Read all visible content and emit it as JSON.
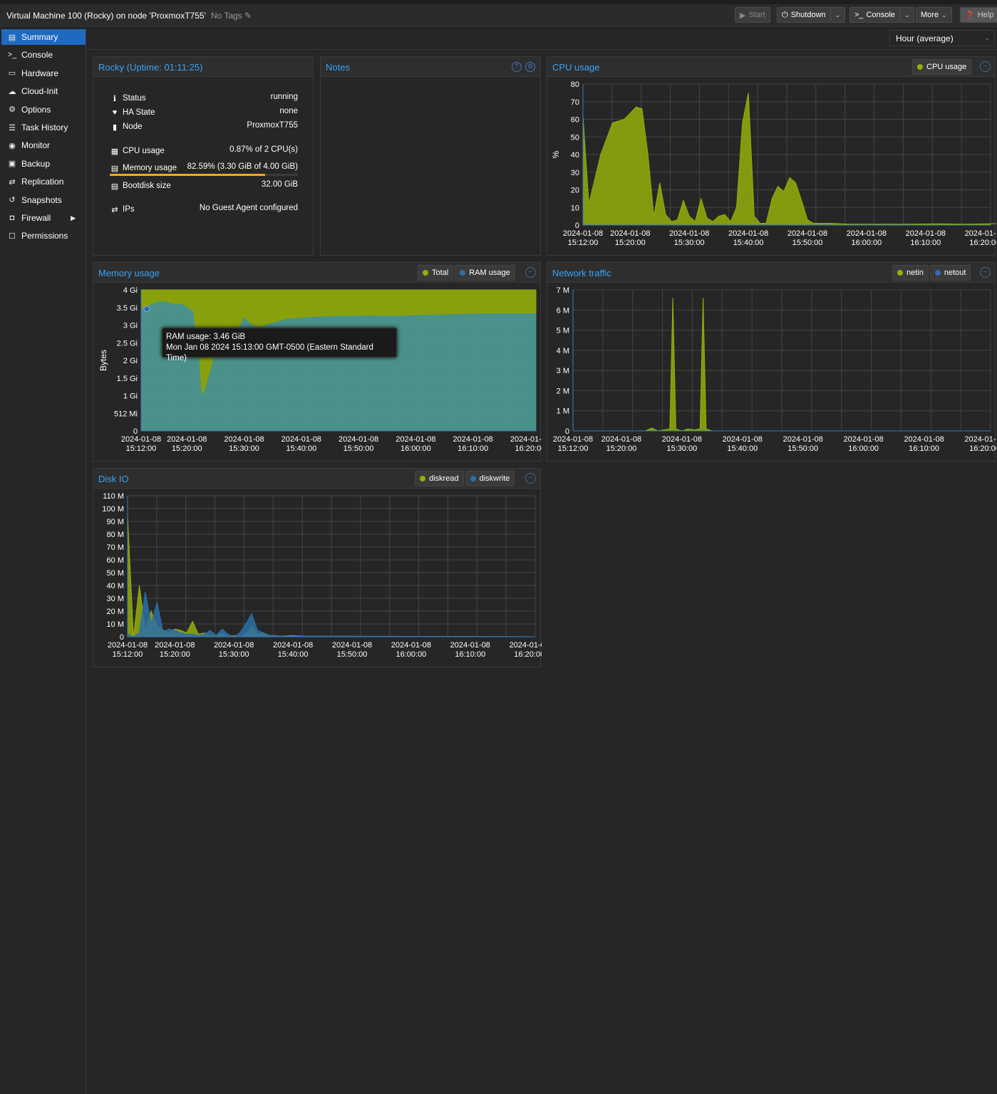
{
  "header": {
    "title": "Virtual Machine 100 (Rocky) on node 'ProxmoxT755'",
    "tags": "No Tags",
    "start": "Start",
    "shutdown": "Shutdown",
    "console": "Console",
    "more": "More",
    "help": "Help"
  },
  "sidebar": {
    "items": [
      {
        "label": "Summary",
        "icon": "book-icon"
      },
      {
        "label": "Console",
        "icon": "terminal-icon"
      },
      {
        "label": "Hardware",
        "icon": "desktop-icon"
      },
      {
        "label": "Cloud-Init",
        "icon": "cloud-icon"
      },
      {
        "label": "Options",
        "icon": "gear-icon"
      },
      {
        "label": "Task History",
        "icon": "list-icon"
      },
      {
        "label": "Monitor",
        "icon": "eye-icon"
      },
      {
        "label": "Backup",
        "icon": "floppy-icon"
      },
      {
        "label": "Replication",
        "icon": "retweet-icon"
      },
      {
        "label": "Snapshots",
        "icon": "history-icon"
      },
      {
        "label": "Firewall",
        "icon": "shield-icon"
      },
      {
        "label": "Permissions",
        "icon": "unlock-icon"
      }
    ]
  },
  "timeframe": "Hour (average)",
  "status": {
    "title": "Rocky (Uptime: 01:11:25)",
    "status_label": "Status",
    "status_value": "running",
    "ha_label": "HA State",
    "ha_value": "none",
    "node_label": "Node",
    "node_value": "ProxmoxT755",
    "cpu_label": "CPU usage",
    "cpu_value": "0.87% of 2 CPU(s)",
    "mem_label": "Memory usage",
    "mem_value": "82.59% (3.30 GiB of 4.00 GiB)",
    "mem_fraction": 0.8259,
    "disk_label": "Bootdisk size",
    "disk_value": "32.00 GiB",
    "ips_label": "IPs",
    "ips_value": "No Guest Agent configured"
  },
  "notes": {
    "title": "Notes"
  },
  "tooltip": {
    "line1": "RAM usage: 3.46 GiB",
    "line2": "Mon Jan 08 2024 15:13:00 GMT-0500 (Eastern Standard Time)"
  },
  "chart_data": [
    {
      "type": "area",
      "title": "CPU usage",
      "ylabel": "%",
      "ylim": [
        0,
        80
      ],
      "yticks": [
        "0",
        "10",
        "20",
        "30",
        "40",
        "50",
        "60",
        "70",
        "80"
      ],
      "xticks": [
        [
          "2024-01-08",
          "15:12:00"
        ],
        [
          "2024-01-08",
          "15:20:00"
        ],
        [
          "2024-01-08",
          "15:30:00"
        ],
        [
          "2024-01-08",
          "15:40:00"
        ],
        [
          "2024-01-08",
          "15:50:00"
        ],
        [
          "2024-01-08",
          "16:00:00"
        ],
        [
          "2024-01-08",
          "16:10:00"
        ],
        [
          "2024-01-08",
          "16:20:00"
        ]
      ],
      "series": [
        {
          "name": "CPU usage",
          "color": "#94ae0a",
          "x": [
            0,
            1,
            3,
            5,
            7,
            9,
            10,
            11,
            12,
            13,
            14,
            15,
            16,
            17,
            18,
            19,
            20,
            21,
            22,
            23,
            24,
            25,
            26,
            27,
            28,
            29,
            30,
            31,
            32,
            33,
            34,
            35,
            36,
            37,
            38,
            39,
            40,
            42,
            45,
            50,
            55,
            60,
            65,
            70,
            75,
            69
          ],
          "values": [
            62,
            12,
            40,
            58,
            60,
            67,
            66,
            40,
            5,
            24,
            6,
            2,
            3,
            14,
            5,
            2,
            15,
            4,
            2,
            5,
            6,
            2,
            10,
            58,
            75,
            5,
            1,
            1,
            15,
            22,
            19,
            27,
            24,
            14,
            3,
            1,
            1,
            1,
            0.5,
            0.5,
            0.5,
            0.7,
            0.5,
            0.8,
            0.6,
            0.8
          ]
        }
      ]
    },
    {
      "type": "area",
      "title": "Memory usage",
      "ylabel": "Bytes",
      "ylim": [
        0,
        4
      ],
      "yticks": [
        "0",
        "512 Mi",
        "1 Gi",
        "1.5 Gi",
        "2 Gi",
        "2.5 Gi",
        "3 Gi",
        "3.5 Gi",
        "4 Gi"
      ],
      "xticks": [
        [
          "2024-01-08",
          "15:12:00"
        ],
        [
          "2024-01-08",
          "15:20:00"
        ],
        [
          "2024-01-08",
          "15:30:00"
        ],
        [
          "2024-01-08",
          "15:40:00"
        ],
        [
          "2024-01-08",
          "15:50:00"
        ],
        [
          "2024-01-08",
          "16:00:00"
        ],
        [
          "2024-01-08",
          "16:10:00"
        ],
        [
          "2024-01-08",
          "16:20:00"
        ]
      ],
      "series": [
        {
          "name": "Total",
          "color": "#94ae0a",
          "x": [
            0,
            69
          ],
          "values": [
            4,
            4
          ]
        },
        {
          "name": "RAM usage",
          "color": "#3f8fa0",
          "x": [
            0,
            1,
            2,
            3,
            4,
            5,
            6,
            7,
            8,
            9,
            10,
            10.5,
            11,
            12,
            13,
            14,
            15,
            16,
            17,
            18,
            19,
            20,
            21,
            22,
            23,
            24,
            25,
            26,
            28,
            30,
            35,
            40,
            45,
            50,
            55,
            60,
            65,
            69
          ],
          "values": [
            3.46,
            3.5,
            3.6,
            3.65,
            3.66,
            3.62,
            3.58,
            3.6,
            3.5,
            3.4,
            2.2,
            1.05,
            1.05,
            1.6,
            2.2,
            2.5,
            2.7,
            2.8,
            2.9,
            3.2,
            3.05,
            2.95,
            2.95,
            3.0,
            3.05,
            3.1,
            3.15,
            3.18,
            3.2,
            3.22,
            3.25,
            3.26,
            3.25,
            3.28,
            3.3,
            3.32,
            3.32,
            3.32
          ]
        }
      ]
    },
    {
      "type": "area",
      "title": "Network traffic",
      "ylim": [
        0,
        7
      ],
      "yticks": [
        "0",
        "1 M",
        "2 M",
        "3 M",
        "4 M",
        "5 M",
        "6 M",
        "7 M"
      ],
      "xticks": [
        [
          "2024-01-08",
          "15:12:00"
        ],
        [
          "2024-01-08",
          "15:20:00"
        ],
        [
          "2024-01-08",
          "15:30:00"
        ],
        [
          "2024-01-08",
          "15:40:00"
        ],
        [
          "2024-01-08",
          "15:50:00"
        ],
        [
          "2024-01-08",
          "16:00:00"
        ],
        [
          "2024-01-08",
          "16:10:00"
        ],
        [
          "2024-01-08",
          "16:20:00"
        ]
      ],
      "series": [
        {
          "name": "netin",
          "color": "#94ae0a",
          "x": [
            0,
            12,
            13,
            14,
            15,
            16,
            16.5,
            17,
            18,
            19,
            20,
            21,
            21.5,
            22,
            23,
            24,
            25,
            26,
            69
          ],
          "values": [
            0,
            0,
            0.15,
            0,
            0.05,
            0.1,
            6.6,
            0.1,
            0,
            0.1,
            0.05,
            0.1,
            6.6,
            0.1,
            0,
            0,
            0,
            0,
            0
          ]
        },
        {
          "name": "netout",
          "color": "#2c6fa8",
          "x": [
            0,
            69
          ],
          "values": [
            0,
            0
          ]
        }
      ]
    },
    {
      "type": "area",
      "title": "Disk IO",
      "ylim": [
        0,
        110
      ],
      "yticks": [
        "0",
        "10 M",
        "20 M",
        "30 M",
        "40 M",
        "50 M",
        "60 M",
        "70 M",
        "80 M",
        "90 M",
        "100 M",
        "110 M"
      ],
      "xticks": [
        [
          "2024-01-08",
          "15:12:00"
        ],
        [
          "2024-01-08",
          "15:20:00"
        ],
        [
          "2024-01-08",
          "15:30:00"
        ],
        [
          "2024-01-08",
          "15:40:00"
        ],
        [
          "2024-01-08",
          "15:50:00"
        ],
        [
          "2024-01-08",
          "16:00:00"
        ],
        [
          "2024-01-08",
          "16:10:00"
        ],
        [
          "2024-01-08",
          "16:20:00"
        ]
      ],
      "series": [
        {
          "name": "diskread",
          "color": "#94ae0a",
          "x": [
            0,
            1,
            2,
            3,
            4,
            5,
            6,
            7,
            8,
            9,
            10,
            11,
            12,
            13,
            14,
            15,
            16,
            17,
            18,
            19,
            20,
            21,
            22,
            23,
            24,
            25,
            26,
            28,
            30,
            69
          ],
          "values": [
            95,
            0,
            40,
            5,
            20,
            8,
            5,
            3,
            6,
            5,
            3,
            12,
            2,
            3,
            1,
            1,
            3,
            0,
            1,
            0,
            2,
            8,
            2,
            3,
            1,
            1,
            0.5,
            1,
            0.5,
            0
          ]
        },
        {
          "name": "diskwrite",
          "color": "#2c6fa8",
          "x": [
            0,
            1,
            2,
            3,
            4,
            5,
            6,
            7,
            8,
            9,
            10,
            11,
            12,
            13,
            14,
            15,
            16,
            17,
            18,
            19,
            20,
            21,
            22,
            23,
            24,
            25,
            26,
            28,
            30,
            69
          ],
          "values": [
            2,
            0,
            3,
            35,
            10,
            27,
            4,
            6,
            5,
            3,
            2,
            2,
            1,
            2,
            5,
            1,
            6,
            2,
            0,
            3,
            10,
            18,
            5,
            3,
            1,
            1,
            0.5,
            0.5,
            0.5,
            0
          ]
        }
      ]
    }
  ]
}
